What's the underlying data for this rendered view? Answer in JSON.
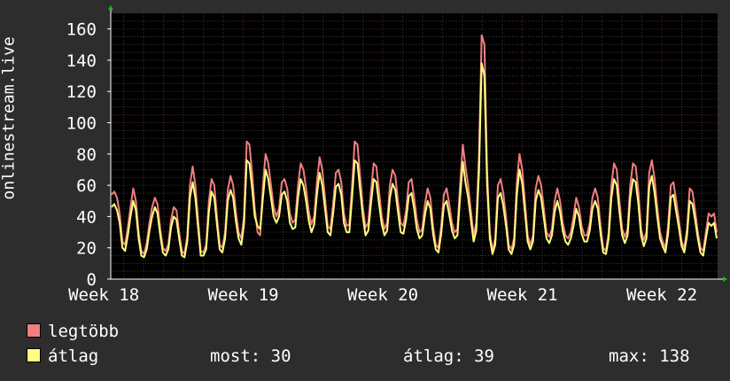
{
  "chart_data": {
    "type": "line",
    "ylabel": "onlinestream.live",
    "ylim": [
      0,
      170
    ],
    "yticks": [
      0,
      20,
      40,
      60,
      80,
      100,
      120,
      140,
      160
    ],
    "xtick_labels": [
      "Week 18",
      "Week 19",
      "Week 20",
      "Week 21",
      "Week 22"
    ],
    "grid": true,
    "colors": {
      "background": "#2d2d2d",
      "plot": "#000000",
      "grid": "#3a3a3a",
      "minor_grid": "#5a2020",
      "axis": "#ffffff",
      "max": "#f07f7f",
      "avg": "#ffff80"
    },
    "series": [
      {
        "name": "legtöbb",
        "color": "#f07f7f",
        "values": [
          54,
          56,
          52,
          42,
          24,
          22,
          33,
          46,
          58,
          50,
          30,
          18,
          16,
          23,
          36,
          46,
          52,
          48,
          32,
          20,
          18,
          22,
          38,
          46,
          44,
          30,
          18,
          16,
          28,
          60,
          72,
          60,
          38,
          18,
          17,
          22,
          50,
          64,
          60,
          40,
          22,
          20,
          30,
          57,
          66,
          60,
          43,
          30,
          26,
          40,
          88,
          86,
          68,
          45,
          30,
          28,
          60,
          80,
          74,
          60,
          46,
          40,
          45,
          62,
          64,
          58,
          42,
          36,
          38,
          60,
          74,
          70,
          58,
          43,
          35,
          40,
          62,
          78,
          70,
          52,
          34,
          32,
          48,
          68,
          70,
          62,
          42,
          34,
          35,
          60,
          88,
          86,
          66,
          46,
          33,
          36,
          56,
          74,
          72,
          56,
          40,
          32,
          36,
          60,
          70,
          66,
          50,
          36,
          34,
          44,
          62,
          64,
          52,
          38,
          30,
          32,
          48,
          58,
          52,
          34,
          22,
          20,
          34,
          54,
          58,
          48,
          36,
          30,
          32,
          60,
          86,
          72,
          60,
          44,
          28,
          36,
          80,
          156,
          150,
          70,
          30,
          18,
          26,
          60,
          64,
          55,
          40,
          22,
          19,
          26,
          62,
          80,
          70,
          50,
          28,
          22,
          28,
          58,
          66,
          60,
          45,
          30,
          27,
          32,
          50,
          58,
          50,
          36,
          28,
          26,
          30,
          40,
          52,
          46,
          34,
          28,
          28,
          36,
          52,
          58,
          52,
          34,
          20,
          18,
          30,
          60,
          74,
          70,
          50,
          32,
          27,
          32,
          60,
          74,
          72,
          56,
          32,
          25,
          30,
          68,
          76,
          64,
          46,
          30,
          24,
          20,
          34,
          60,
          62,
          50,
          38,
          24,
          20,
          32,
          58,
          56,
          44,
          30,
          20,
          18,
          30,
          42,
          40,
          42,
          30
        ]
      },
      {
        "name": "átlag",
        "color": "#ffff80",
        "values": [
          46,
          48,
          44,
          36,
          20,
          18,
          28,
          40,
          50,
          44,
          26,
          15,
          14,
          19,
          31,
          40,
          46,
          42,
          28,
          17,
          15,
          19,
          33,
          40,
          38,
          26,
          15,
          14,
          24,
          52,
          62,
          52,
          33,
          15,
          15,
          19,
          43,
          56,
          52,
          35,
          19,
          17,
          26,
          50,
          57,
          52,
          37,
          26,
          22,
          35,
          76,
          74,
          58,
          40,
          34,
          32,
          52,
          70,
          64,
          52,
          40,
          36,
          40,
          54,
          56,
          50,
          36,
          32,
          33,
          52,
          64,
          60,
          50,
          37,
          30,
          35,
          54,
          68,
          60,
          45,
          30,
          28,
          42,
          59,
          61,
          54,
          36,
          30,
          30,
          52,
          76,
          74,
          57,
          40,
          28,
          31,
          48,
          64,
          62,
          48,
          35,
          28,
          31,
          52,
          61,
          57,
          43,
          30,
          29,
          38,
          53,
          55,
          45,
          32,
          26,
          28,
          41,
          50,
          45,
          29,
          19,
          17,
          29,
          47,
          50,
          41,
          31,
          26,
          28,
          52,
          75,
          62,
          52,
          38,
          24,
          31,
          69,
          138,
          130,
          61,
          26,
          16,
          22,
          52,
          55,
          47,
          34,
          19,
          16,
          22,
          54,
          70,
          61,
          43,
          24,
          19,
          24,
          50,
          57,
          52,
          39,
          26,
          23,
          28,
          43,
          50,
          43,
          31,
          24,
          22,
          26,
          34,
          45,
          40,
          29,
          24,
          24,
          31,
          45,
          50,
          45,
          29,
          17,
          16,
          26,
          52,
          64,
          60,
          43,
          28,
          23,
          28,
          52,
          64,
          62,
          48,
          28,
          21,
          26,
          59,
          66,
          55,
          40,
          26,
          21,
          17,
          29,
          52,
          54,
          43,
          33,
          21,
          17,
          28,
          50,
          48,
          38,
          26,
          17,
          15,
          26,
          36,
          34,
          36,
          26
        ]
      }
    ]
  },
  "legend": [
    {
      "label": "legtöbb",
      "color": "#f07f7f"
    },
    {
      "label": "átlag",
      "color": "#ffff80"
    }
  ],
  "stats": [
    {
      "label": "most:",
      "value": "30"
    },
    {
      "label": "átlag:",
      "value": "39"
    },
    {
      "label": "max:",
      "value": "138"
    }
  ]
}
